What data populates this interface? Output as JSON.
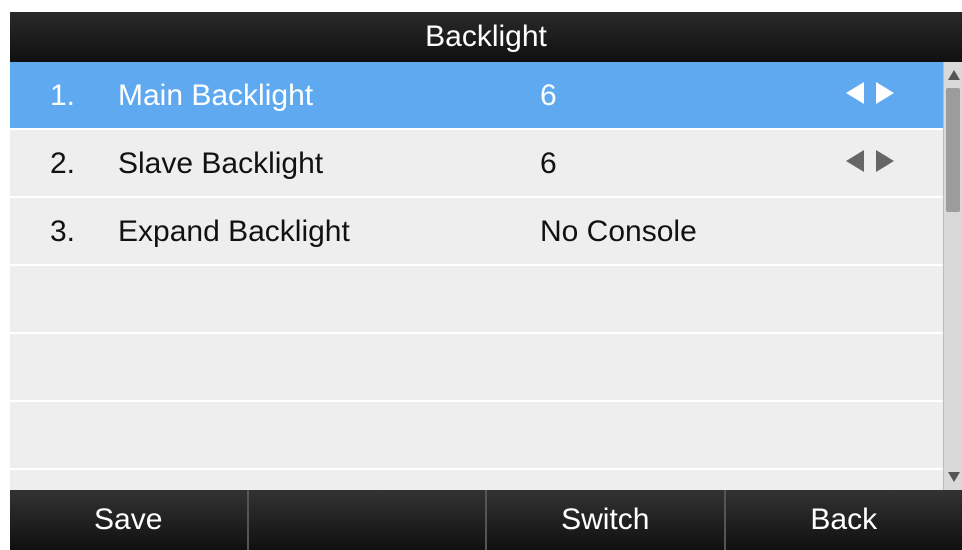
{
  "header": {
    "title": "Backlight"
  },
  "items": [
    {
      "num": "1.",
      "label": "Main Backlight",
      "value": "6",
      "has_arrows": true,
      "selected": true
    },
    {
      "num": "2.",
      "label": "Slave Backlight",
      "value": "6",
      "has_arrows": true,
      "selected": false
    },
    {
      "num": "3.",
      "label": "Expand Backlight",
      "value": "No Console",
      "has_arrows": false,
      "selected": false
    }
  ],
  "softkeys": [
    {
      "label": "Save"
    },
    {
      "label": ""
    },
    {
      "label": "Switch"
    },
    {
      "label": "Back"
    }
  ],
  "colors": {
    "selected_row": "#5fa9f0",
    "list_background": "#eeeeee",
    "title_bar": "#1a1a1a"
  },
  "icons": [
    "left-arrow-icon",
    "right-arrow-icon",
    "scroll-up-icon",
    "scroll-down-icon"
  ]
}
